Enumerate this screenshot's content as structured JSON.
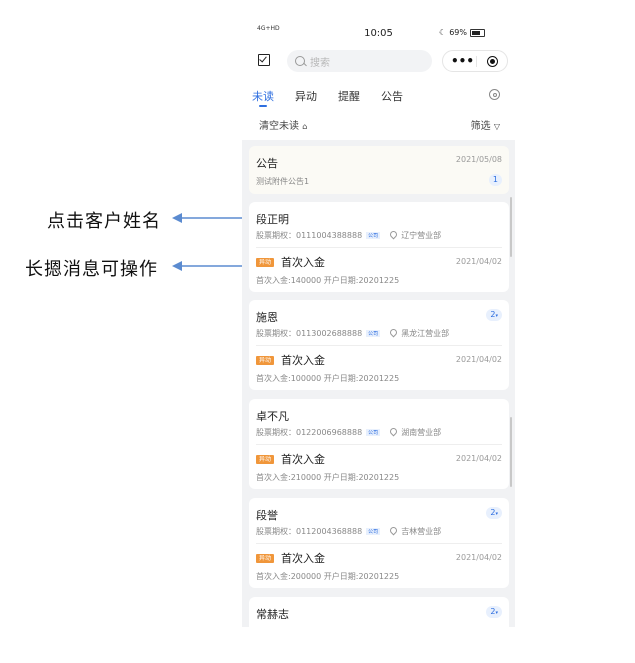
{
  "annotations": {
    "click_name": "点击客户姓名",
    "long_press": "长摁消息可操作"
  },
  "status_bar": {
    "network": "4G+HD",
    "time": "10:05",
    "battery": "69%"
  },
  "search": {
    "placeholder": "搜索"
  },
  "tabs": [
    {
      "label": "未读",
      "active": true
    },
    {
      "label": "异动",
      "active": false
    },
    {
      "label": "提醒",
      "active": false
    },
    {
      "label": "公告",
      "active": false
    }
  ],
  "toolbar": {
    "clear_label": "清空未读",
    "filter_label": "筛选"
  },
  "notice_card": {
    "title": "公告",
    "date": "2021/05/08",
    "subtitle": "测试附件公告1",
    "count": "1"
  },
  "customer_cards": [
    {
      "name": "段正明",
      "count": "",
      "account": "股票期权：0111004388888",
      "tag": "公司",
      "branch": "辽宁营业部",
      "event_tag": "异动",
      "event": "首次入金",
      "date": "2021/04/02",
      "detail": "首次入金:140000   开户日期:20201225"
    },
    {
      "name": "施恩",
      "count": "2",
      "account": "股票期权：0113002688888",
      "tag": "公司",
      "branch": "黑龙江营业部",
      "event_tag": "异动",
      "event": "首次入金",
      "date": "2021/04/02",
      "detail": "首次入金:100000   开户日期:20201225"
    },
    {
      "name": "卓不凡",
      "count": "",
      "account": "股票期权：0122006968888",
      "tag": "公司",
      "branch": "湖南营业部",
      "event_tag": "异动",
      "event": "首次入金",
      "date": "2021/04/02",
      "detail": "首次入金:210000   开户日期:20201225"
    },
    {
      "name": "段誉",
      "count": "2",
      "account": "股票期权：0112004368888",
      "tag": "公司",
      "branch": "吉林营业部",
      "event_tag": "异动",
      "event": "首次入金",
      "date": "2021/04/02",
      "detail": "首次入金:200000   开户日期:20201225"
    },
    {
      "name": "常赫志",
      "count": "2"
    }
  ],
  "colors": {
    "accent": "#2f6fe0",
    "event_tag": "#f0963a",
    "background": "#f1f2f4"
  }
}
